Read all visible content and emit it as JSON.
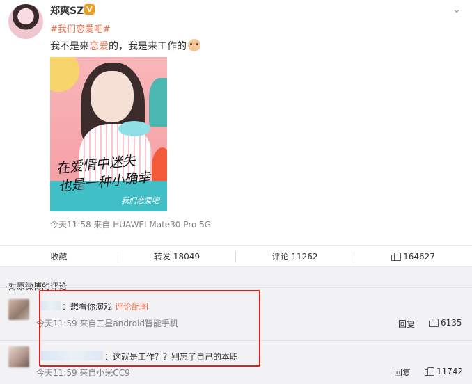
{
  "post": {
    "username": "郑爽SZ",
    "vip_badge": "V",
    "hashtag": "#我们恋爱吧#",
    "content_before": "我不是来",
    "content_highlight": "恋爱",
    "content_after": "的，我是来工作的",
    "image_text_line1": "在爱情中迷失",
    "image_text_line2": "也是一种小确幸",
    "image_stamp": "我们恋爱吧",
    "meta": "今天11:58  来自 HUAWEI Mate30 Pro 5G"
  },
  "actions": {
    "collect": "收藏",
    "repost": "转发 18049",
    "comment": "评论 11262",
    "like": "164627"
  },
  "comments_section": {
    "title": "对原微博的评论",
    "items": [
      {
        "text": "：想看你演戏",
        "link": "评论配图",
        "meta": "今天11:59 来自三星android智能手机",
        "reply": "回复",
        "likes": "6135"
      },
      {
        "text": "：这就是工作？？别忘了自己的本职",
        "meta": "今天11:59 来自小米CC9",
        "reply": "回复",
        "likes": "11742"
      }
    ]
  },
  "colors": {
    "accent": "#eb7350",
    "highlight_box": "#e02020",
    "comment_bg": "#f2f2f5"
  }
}
